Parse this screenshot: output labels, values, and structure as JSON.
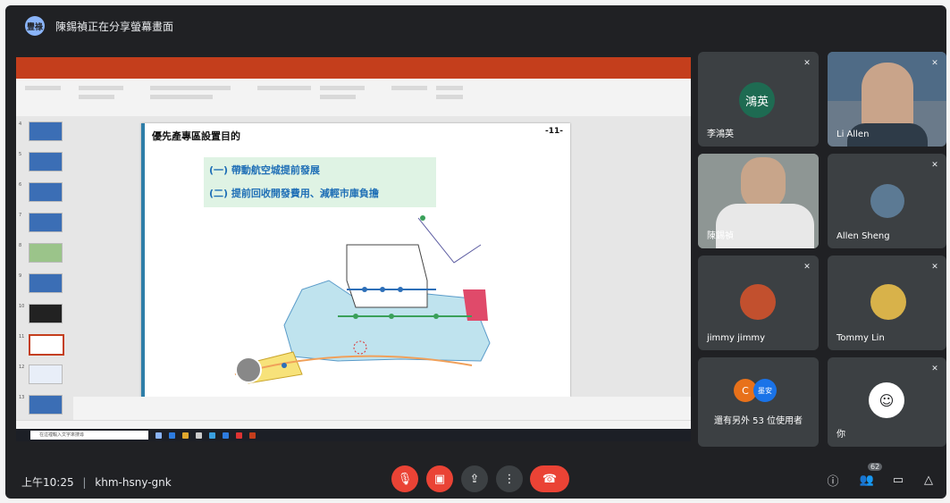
{
  "meeting": {
    "presenter_banner": "陳錫禎正在分享螢幕畫面",
    "logo_text": "豐祿",
    "time": "上午10:25",
    "separator": "|",
    "code": "khm-hsny-gnk",
    "people_count": "62"
  },
  "presentation": {
    "slide_title": "優先產專區設置目的",
    "slide_number": "-11-",
    "goal_1": "(一) 帶動航空城提前發展",
    "goal_2": "(二) 提前回收開發費用、減輕市庫負擔",
    "thumbnail_numbers": [
      "4",
      "5",
      "6",
      "7",
      "8",
      "9",
      "10",
      "11",
      "12",
      "13"
    ],
    "selected_slide": "11"
  },
  "taskbar": {
    "search_placeholder": "在這裡輸入文字來搜尋"
  },
  "participants": [
    {
      "name": "李鴻英",
      "avatar_text": "鴻英",
      "avatar_color": "#1e6b52",
      "muted": true
    },
    {
      "name": "Li Allen",
      "video": true,
      "muted": true
    },
    {
      "name": "陳錫禎",
      "video": true,
      "muted": false
    },
    {
      "name": "Allen Sheng",
      "muted": true
    },
    {
      "name": "jimmy jimmy",
      "muted": true
    },
    {
      "name": "Tommy Lin",
      "muted": true
    },
    {
      "name": "還有另外 53 位使用者",
      "avatar_text_1": "C",
      "avatar_text_2": "墨安",
      "muted": false
    },
    {
      "name": "你",
      "muted": true
    }
  ],
  "colors": {
    "background": "#202124",
    "tile": "#3c4043",
    "red": "#ea4335",
    "slide_bar": "#2e7ea8",
    "goal_text": "#1f6fb6",
    "goal_bg": "#dff3e4"
  }
}
